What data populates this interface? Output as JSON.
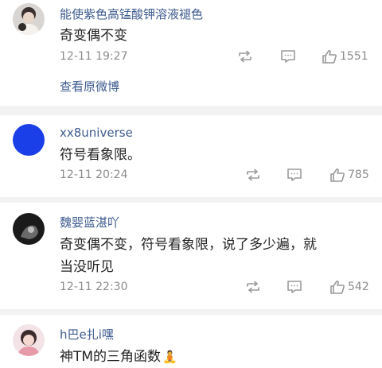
{
  "comments": [
    {
      "username": "能使紫色高锰酸钾溶液褪色",
      "text": "奇变偶不变",
      "time": "12-11 19:27",
      "likes": "1551",
      "view_original": "查看原微博"
    },
    {
      "username": "xx8universe",
      "text": "符号看象限。",
      "time": "12-11 20:24",
      "likes": "785"
    },
    {
      "username": "魏婴蓝湛吖",
      "text_line1": "奇变偶不变，符号看象限，说了多少遍，就",
      "text_line2": "当没听见",
      "time": "12-11 22:30",
      "likes": "542"
    },
    {
      "username": "h巴e扎i嘿",
      "text": "神TM的三角函数",
      "emoji": "🧘"
    }
  ],
  "colors": {
    "username": "#3e5b8f",
    "body_text": "#222222",
    "meta_text": "#8c8c8c",
    "separator": "#f2f2f2",
    "avatar_blue": "#1a3fe8"
  },
  "icons": [
    "repost-icon",
    "comment-icon",
    "like-icon"
  ]
}
